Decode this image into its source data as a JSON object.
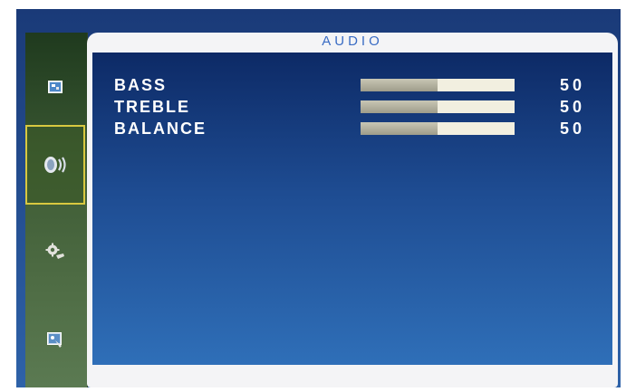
{
  "menu": {
    "title": "AUDIO",
    "sidebar": [
      {
        "icon": "picture-icon",
        "selected": false
      },
      {
        "icon": "speaker-icon",
        "selected": true
      },
      {
        "icon": "gear-icon",
        "selected": false
      },
      {
        "icon": "display-icon",
        "selected": false
      }
    ],
    "settings": [
      {
        "label": "BASS",
        "value": "50",
        "level": 0.5
      },
      {
        "label": "TREBLE",
        "value": "50",
        "level": 0.5
      },
      {
        "label": "BALANCE",
        "value": "50",
        "level": 0.5
      }
    ]
  },
  "colors": {
    "title": "#3a6cc4",
    "selection_border": "#d8c840",
    "slider_track": "#f2efe0"
  }
}
